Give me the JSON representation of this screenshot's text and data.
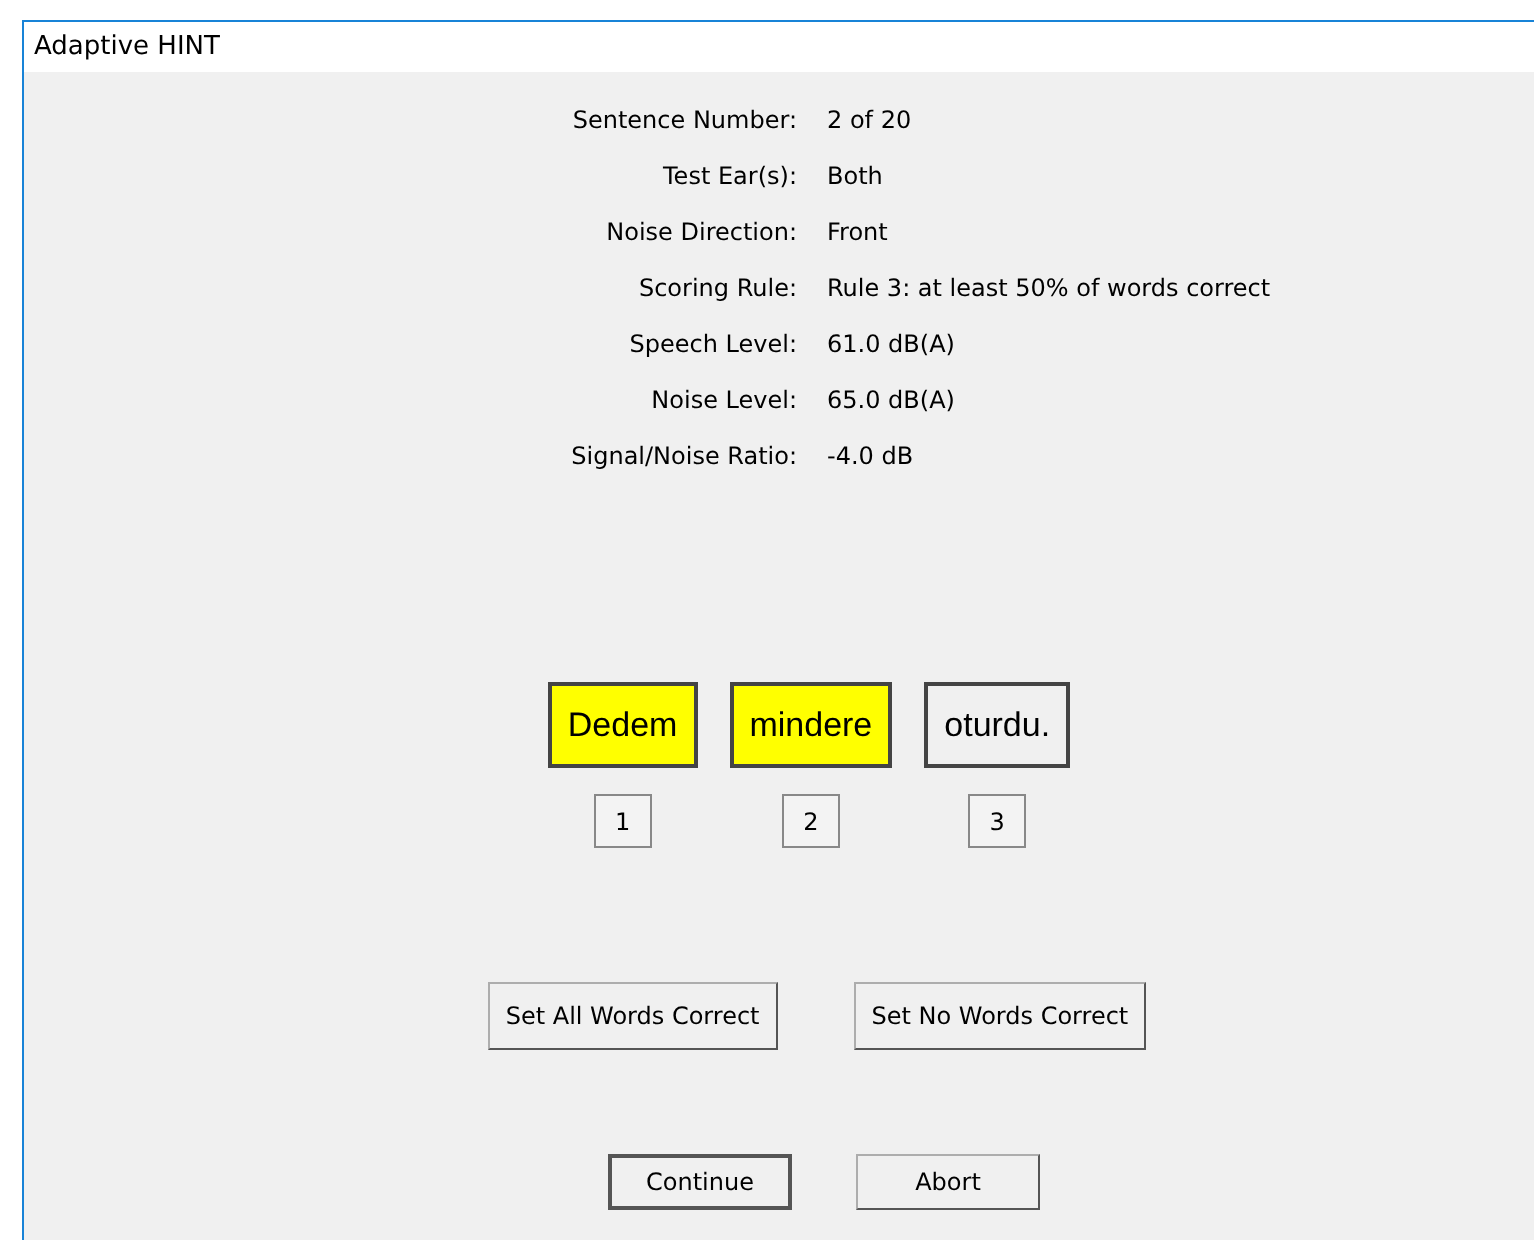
{
  "window": {
    "title": "Adaptive HINT"
  },
  "info": [
    {
      "label": "Sentence Number:",
      "value": "2 of 20"
    },
    {
      "label": "Test Ear(s):",
      "value": "Both"
    },
    {
      "label": "Noise Direction:",
      "value": "Front"
    },
    {
      "label": "Scoring Rule:",
      "value": "Rule 3: at least 50% of words correct"
    },
    {
      "label": "Speech Level:",
      "value": "61.0 dB(A)"
    },
    {
      "label": "Noise Level:",
      "value": "65.0 dB(A)"
    },
    {
      "label": "Signal/Noise Ratio:",
      "value": "-4.0 dB"
    }
  ],
  "words": [
    {
      "text": "Dedem",
      "number": "1",
      "selected": true
    },
    {
      "text": "mindere",
      "number": "2",
      "selected": true
    },
    {
      "text": "oturdu.",
      "number": "3",
      "selected": false
    }
  ],
  "bulk_buttons": [
    "Set All Words Correct",
    "Set No Words Correct"
  ],
  "buttons": [
    {
      "label": "Continue",
      "default": true
    },
    {
      "label": "Abort",
      "default": false
    }
  ]
}
